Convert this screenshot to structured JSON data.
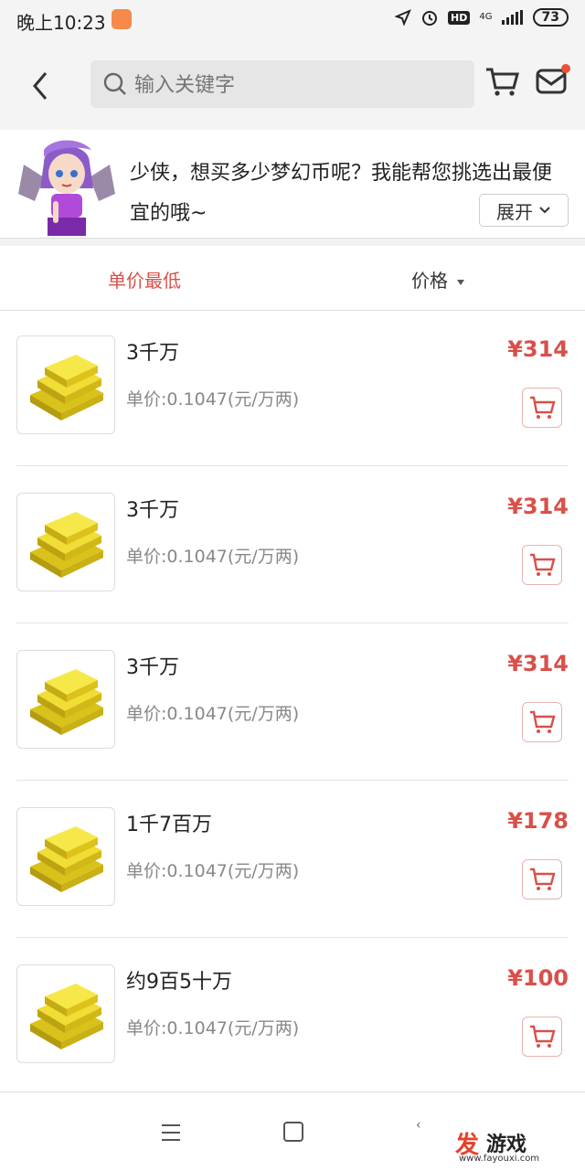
{
  "status_bar": {
    "time": "晚上10:23",
    "hd": "HD",
    "network": "4G",
    "battery": "73"
  },
  "header": {
    "search_placeholder": "输入关键字"
  },
  "banner": {
    "message": "少侠，想买多少梦幻币呢？我能帮您挑选出最便宜的哦~",
    "expand_label": "展开"
  },
  "sort": {
    "lowest_unit_price": "单价最低",
    "price": "价格"
  },
  "products": [
    {
      "title": "3千万",
      "unit_price": "单价:0.1047(元/万两)",
      "price": "¥314"
    },
    {
      "title": "3千万",
      "unit_price": "单价:0.1047(元/万两)",
      "price": "¥314"
    },
    {
      "title": "3千万",
      "unit_price": "单价:0.1047(元/万两)",
      "price": "¥314"
    },
    {
      "title": "1千7百万",
      "unit_price": "单价:0.1047(元/万两)",
      "price": "¥178"
    },
    {
      "title": "约9百5十万",
      "unit_price": "单价:0.1047(元/万两)",
      "price": "¥100"
    }
  ],
  "watermark": {
    "char1": "发",
    "chars": "游戏",
    "url": "www.fayouxi.com"
  },
  "colors": {
    "accent": "#d9504a",
    "gold": "#e6cf1f"
  }
}
